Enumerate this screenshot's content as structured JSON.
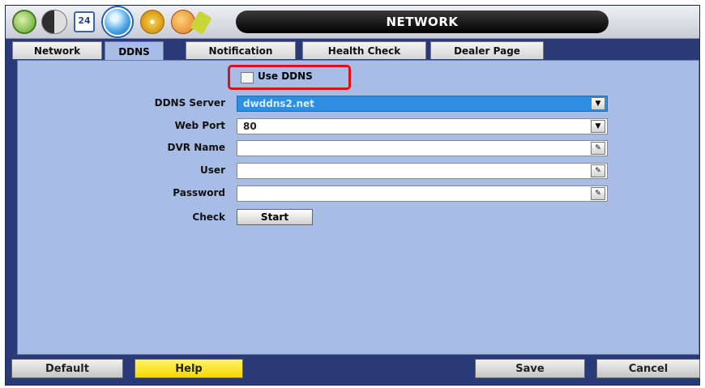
{
  "window": {
    "title": "NETWORK"
  },
  "toolbar_icons": [
    "system-settings-icon",
    "record-settings-icon",
    "calendar-icon",
    "network-globe-icon",
    "disc-backup-icon",
    "tools-icon"
  ],
  "calendar_icon_text": "24",
  "tabs": [
    {
      "label": "Network",
      "active": false
    },
    {
      "label": "DDNS",
      "active": true
    },
    {
      "label": "Notification",
      "active": false
    },
    {
      "label": "Health Check",
      "active": false
    },
    {
      "label": "Dealer Page",
      "active": false
    }
  ],
  "ddns": {
    "use_ddns_label": "Use DDNS",
    "use_ddns_checked": false,
    "server_label": "DDNS Server",
    "server_value": "dwddns2.net",
    "web_port_label": "Web Port",
    "web_port_value": "80",
    "dvr_name_label": "DVR Name",
    "dvr_name_value": "",
    "user_label": "User",
    "user_value": "",
    "password_label": "Password",
    "password_value": "",
    "check_label": "Check",
    "start_label": "Start"
  },
  "footer": {
    "default_label": "Default",
    "help_label": "Help",
    "save_label": "Save",
    "cancel_label": "Cancel"
  },
  "colors": {
    "panel": "#a8bde6",
    "frame": "#2a3a78",
    "selected_field": "#2e8fe0",
    "highlight": "#e0101a",
    "help_button": "#f3d800"
  }
}
